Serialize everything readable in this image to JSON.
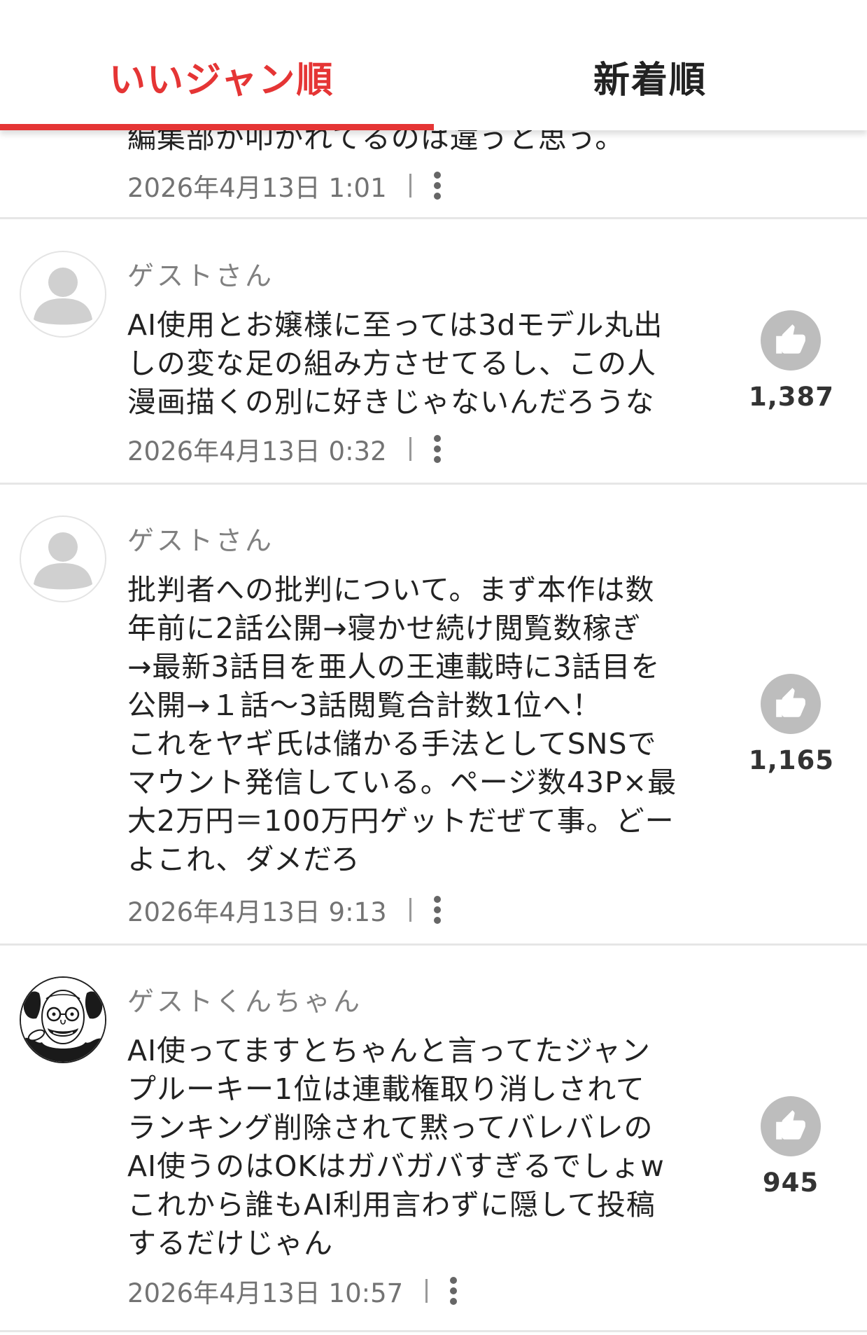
{
  "tabs": {
    "popular": "いいジャン順",
    "newest": "新着順"
  },
  "comments": [
    {
      "body": "編集部が叩かれてるのは違うと思う。",
      "date": "2026年4月13日 1:01"
    },
    {
      "author": "ゲストさん",
      "body": "AI使用とお嬢様に至っては3dモデル丸出\nしの変な足の組み方させてるし、この人\n漫画描くの別に好きじゃないんだろうな",
      "date": "2026年4月13日 0:32",
      "likes": "1,387"
    },
    {
      "author": "ゲストさん",
      "body": "批判者への批判について。まず本作は数\n年前に2話公開→寝かせ続け閲覧数稼ぎ\n→最新3話目を亜人の王連載時に3話目を\n公開→１話〜3話閲覧合計数1位へ！\nこれをヤギ氏は儲かる手法としてSNSで\nマウント発信している。ページ数43P×最\n大2万円＝100万円ゲットだぜて事。どー\nよこれ、ダメだろ",
      "date": "2026年4月13日 9:13",
      "likes": "1,165"
    },
    {
      "author": "ゲストくんちゃん",
      "body": "AI使ってますとちゃんと言ってたジャン\nプルーキー1位は連載権取り消しされて\nランキング削除されて黙ってバレバレの\nAI使うのはOKはガバガバすぎるでしょw\nこれから誰もAI利用言わずに隠して投稿\nするだけじゃん",
      "date": "2026年4月13日 10:57",
      "likes": "945"
    }
  ]
}
